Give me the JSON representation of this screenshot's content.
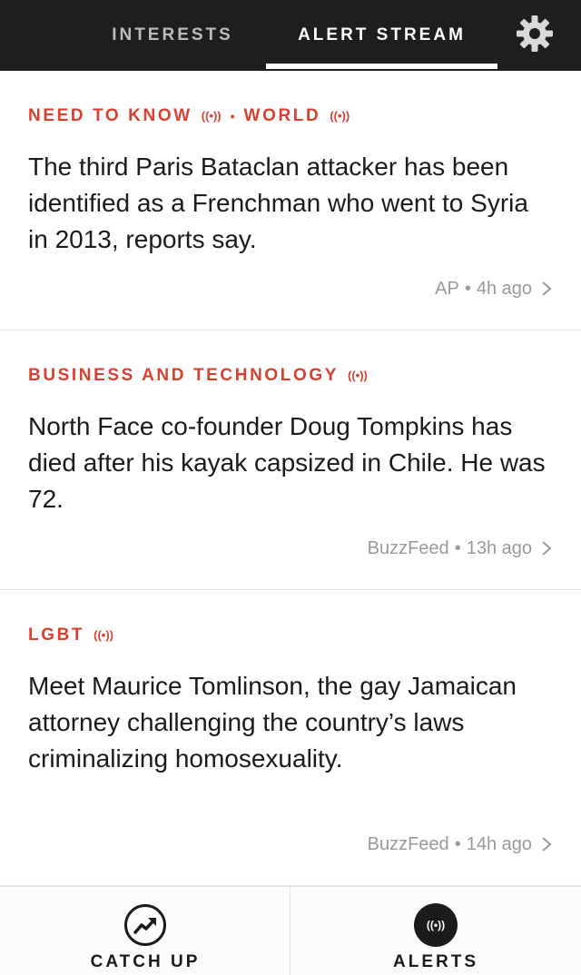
{
  "nav": {
    "tabs": [
      {
        "label": "INTERESTS",
        "active": false
      },
      {
        "label": "ALERT STREAM",
        "active": true
      }
    ],
    "settings_icon": "gear-icon"
  },
  "broadcast_glyph": "((•))",
  "separator_glyph": "•",
  "alerts": [
    {
      "tags": [
        "NEED TO KNOW",
        "WORLD"
      ],
      "headline": "The third Paris Bataclan attacker has been identified as a Frenchman who went to Syria in 2013, reports say.",
      "source": "AP",
      "time": "4h ago"
    },
    {
      "tags": [
        "BUSINESS AND TECHNOLOGY"
      ],
      "headline": "North Face co-founder Doug Tompkins has died after his kayak capsized in Chile. He was 72.",
      "source": "BuzzFeed",
      "time": "13h ago"
    },
    {
      "tags": [
        "LGBT"
      ],
      "headline": "Meet Maurice Tomlinson, the gay Jamaican attorney challenging the country’s laws criminalizing homosexuality.",
      "source": "BuzzFeed",
      "time": "14h ago"
    }
  ],
  "bottom_nav": {
    "catch_up": {
      "label": "CATCH UP",
      "icon": "trending-icon"
    },
    "alerts": {
      "label": "ALERTS",
      "icon": "broadcast-icon",
      "active": true
    }
  },
  "colors": {
    "accent": "#d8412f",
    "topbar": "#1e1e1e",
    "meta_text": "#9a9a9a"
  }
}
